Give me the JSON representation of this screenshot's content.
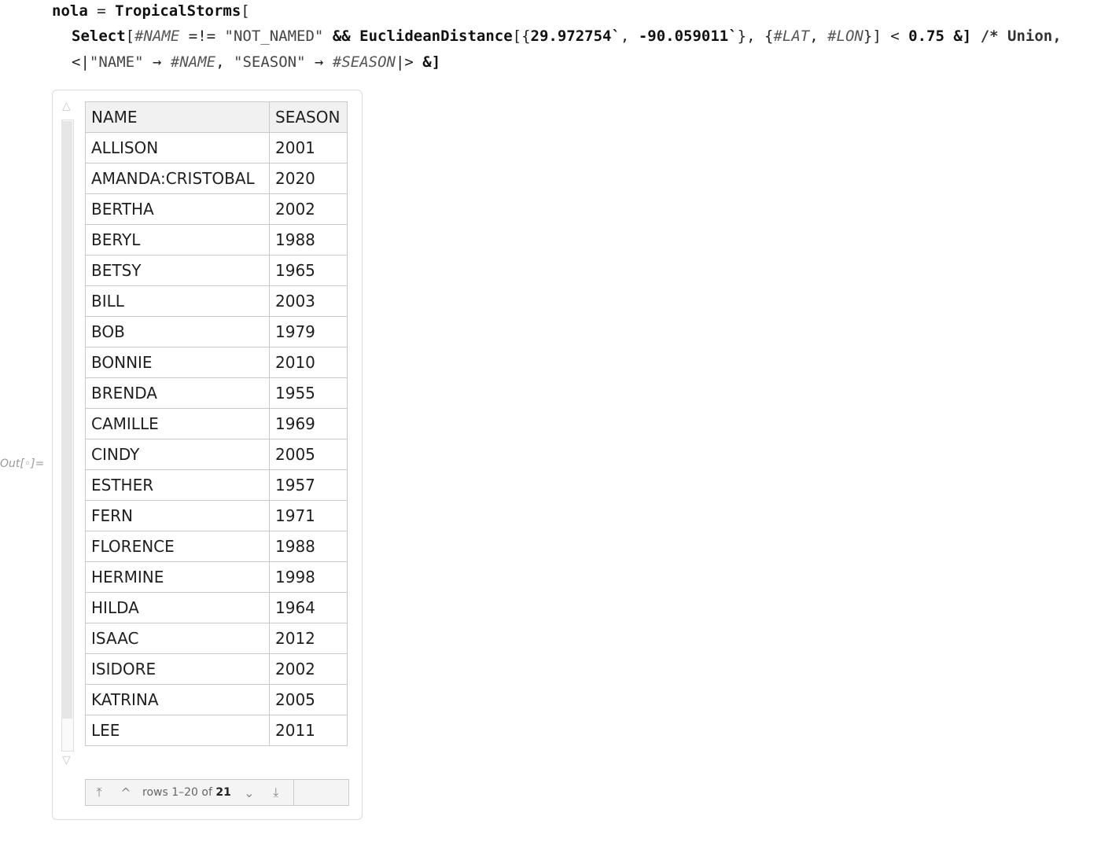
{
  "input": {
    "line1": {
      "var": "nola",
      "eq": "=",
      "func": "TropicalStorms",
      "open": "["
    },
    "line2": {
      "select": "Select",
      "open": "[",
      "slot_name": "#NAME",
      "neq": "=!=",
      "str_not_named": "\"NOT_NAMED\"",
      "and": "&&",
      "euclid": "EuclideanDistance",
      "args_open": "[{",
      "lat": "29.972754`",
      "comma": ",",
      "lon": "-90.059011`",
      "args_mid": "}, {",
      "slot_lat": "#LAT",
      "slot_lon": "#LON",
      "args_close": "}]",
      "lt": "<",
      "threshold": "0.75",
      "amp_close": "&]",
      "comment": "/* Union,"
    },
    "line3": {
      "assoc_open": "<|",
      "key_name": "\"NAME\"",
      "arrow": "→",
      "slot_name": "#NAME",
      "comma": ",",
      "key_season": "\"SEASON\"",
      "slot_season": "#SEASON",
      "assoc_close": "|>",
      "amp_close": "&]"
    }
  },
  "output_label": "Out[◦]=",
  "table": {
    "columns": [
      "NAME",
      "SEASON"
    ],
    "rows": [
      [
        "ALLISON",
        "2001"
      ],
      [
        "AMANDA:CRISTOBAL",
        "2020"
      ],
      [
        "BERTHA",
        "2002"
      ],
      [
        "BERYL",
        "1988"
      ],
      [
        "BETSY",
        "1965"
      ],
      [
        "BILL",
        "2003"
      ],
      [
        "BOB",
        "1979"
      ],
      [
        "BONNIE",
        "2010"
      ],
      [
        "BRENDA",
        "1955"
      ],
      [
        "CAMILLE",
        "1969"
      ],
      [
        "CINDY",
        "2005"
      ],
      [
        "ESTHER",
        "1957"
      ],
      [
        "FERN",
        "1971"
      ],
      [
        "FLORENCE",
        "1988"
      ],
      [
        "HERMINE",
        "1998"
      ],
      [
        "HILDA",
        "1964"
      ],
      [
        "ISAAC",
        "2012"
      ],
      [
        "ISIDORE",
        "2002"
      ],
      [
        "KATRINA",
        "2005"
      ],
      [
        "LEE",
        "2011"
      ]
    ]
  },
  "pager": {
    "rows_text": "rows 1–20 of",
    "total": "21",
    "icons": [
      "first-page-icon",
      "previous-page-icon",
      "next-page-icon",
      "last-page-icon"
    ]
  },
  "scroll_icons": [
    "scroll-up-icon",
    "scroll-down-icon"
  ]
}
